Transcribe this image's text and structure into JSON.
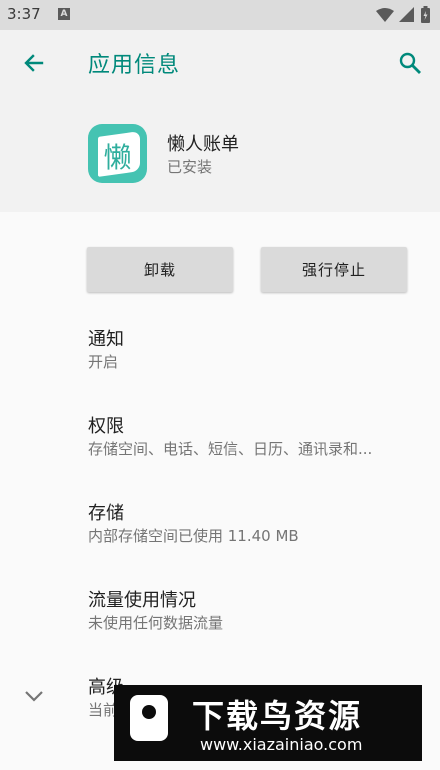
{
  "status_bar": {
    "time": "3:37",
    "notification_icon": "A",
    "icons": [
      "wifi-icon",
      "signal-icon",
      "battery-icon"
    ]
  },
  "header": {
    "title": "应用信息",
    "back_icon": "arrow-left-icon",
    "search_icon": "search-icon"
  },
  "app": {
    "name": "懒人账单",
    "install_status": "已安装",
    "icon_glyph": "懒",
    "icon_color": "#45c3b2"
  },
  "buttons": {
    "uninstall": "卸载",
    "force_stop": "强行停止"
  },
  "preferences": [
    {
      "title": "通知",
      "summary": "开启"
    },
    {
      "title": "权限",
      "summary": "存储空间、电话、短信、日历、通讯录和..."
    },
    {
      "title": "存储",
      "summary": "内部存储空间已使用 11.40 MB"
    },
    {
      "title": "流量使用情况",
      "summary": "未使用任何数据流量"
    },
    {
      "title": "高级",
      "summary": "当前"
    }
  ],
  "watermark": {
    "title": "下载鸟资源",
    "url": "www.xiazainiao.com"
  },
  "colors": {
    "accent": "#00897b",
    "header_bg": "#f2f2f2",
    "status_bar_bg": "#dcdcdc",
    "button_bg": "#dadada"
  }
}
